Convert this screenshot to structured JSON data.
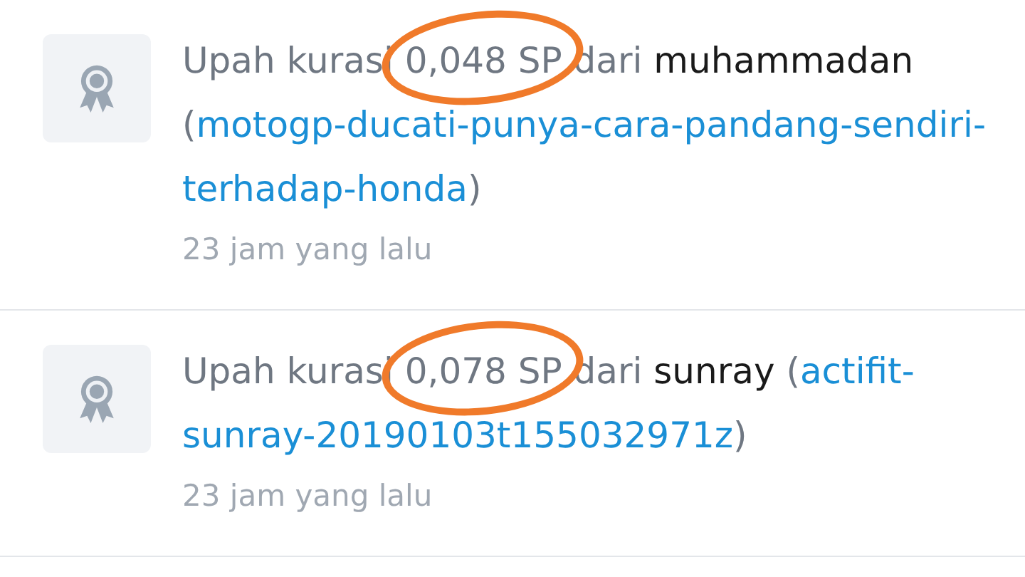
{
  "items": [
    {
      "prefix": "Upah kurasi",
      "amount": "0,048 SP",
      "middle": "dari",
      "author": "muhammadan",
      "open": "(",
      "link": "motogp-ducati-punya-cara-pandang-sendiri-terhadap-honda",
      "close": ")",
      "time": "23 jam yang lalu",
      "circled": true
    },
    {
      "prefix": "Upah kurasi",
      "amount": "0,078 SP",
      "middle": "dari",
      "author": "sunray",
      "open": "(",
      "link": "actifit-sunray-20190103t155032971z",
      "close": ")",
      "time": "23 jam yang lalu",
      "circled": true
    }
  ]
}
